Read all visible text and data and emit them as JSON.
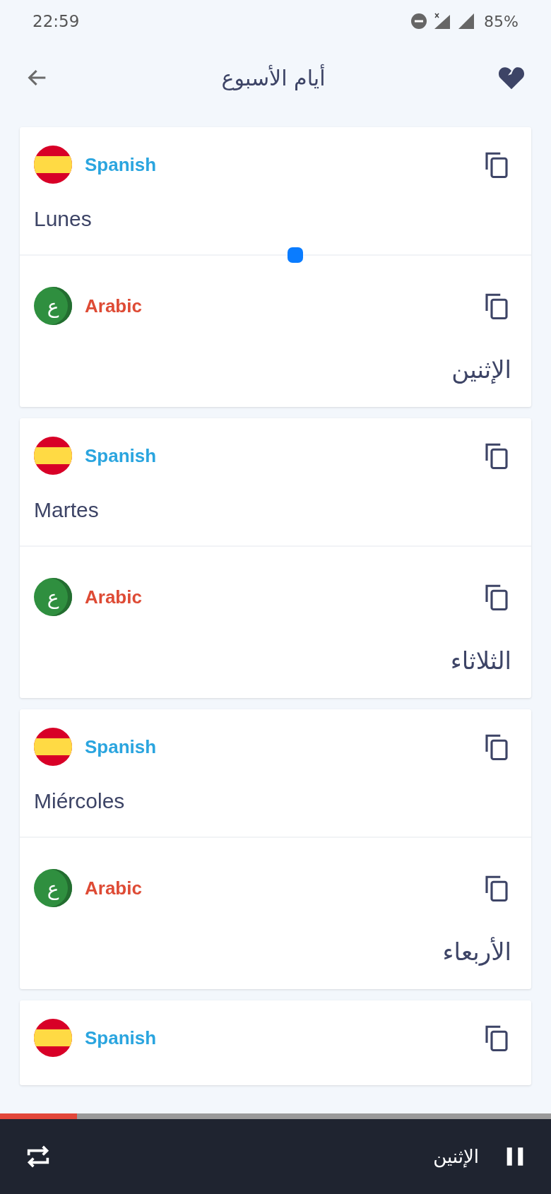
{
  "status_bar": {
    "time": "22:59",
    "battery": "85%"
  },
  "header": {
    "title": "أيام الأسبوع"
  },
  "cards": [
    {
      "entries": [
        {
          "kind": "es",
          "language": "Spanish",
          "text": "Lunes"
        },
        {
          "kind": "ar",
          "language": "Arabic",
          "icon_glyph": "ع",
          "text": "الإثنين"
        }
      ]
    },
    {
      "entries": [
        {
          "kind": "es",
          "language": "Spanish",
          "text": "Martes"
        },
        {
          "kind": "ar",
          "language": "Arabic",
          "icon_glyph": "ع",
          "text": "الثلاثاء"
        }
      ]
    },
    {
      "entries": [
        {
          "kind": "es",
          "language": "Spanish",
          "text": "Miércoles"
        },
        {
          "kind": "ar",
          "language": "Arabic",
          "icon_glyph": "ع",
          "text": "الأربعاء"
        }
      ]
    },
    {
      "entries": [
        {
          "kind": "es",
          "language": "Spanish"
        }
      ]
    }
  ],
  "player": {
    "level": 0.14,
    "now_playing": "الإثنين",
    "playing": true
  }
}
